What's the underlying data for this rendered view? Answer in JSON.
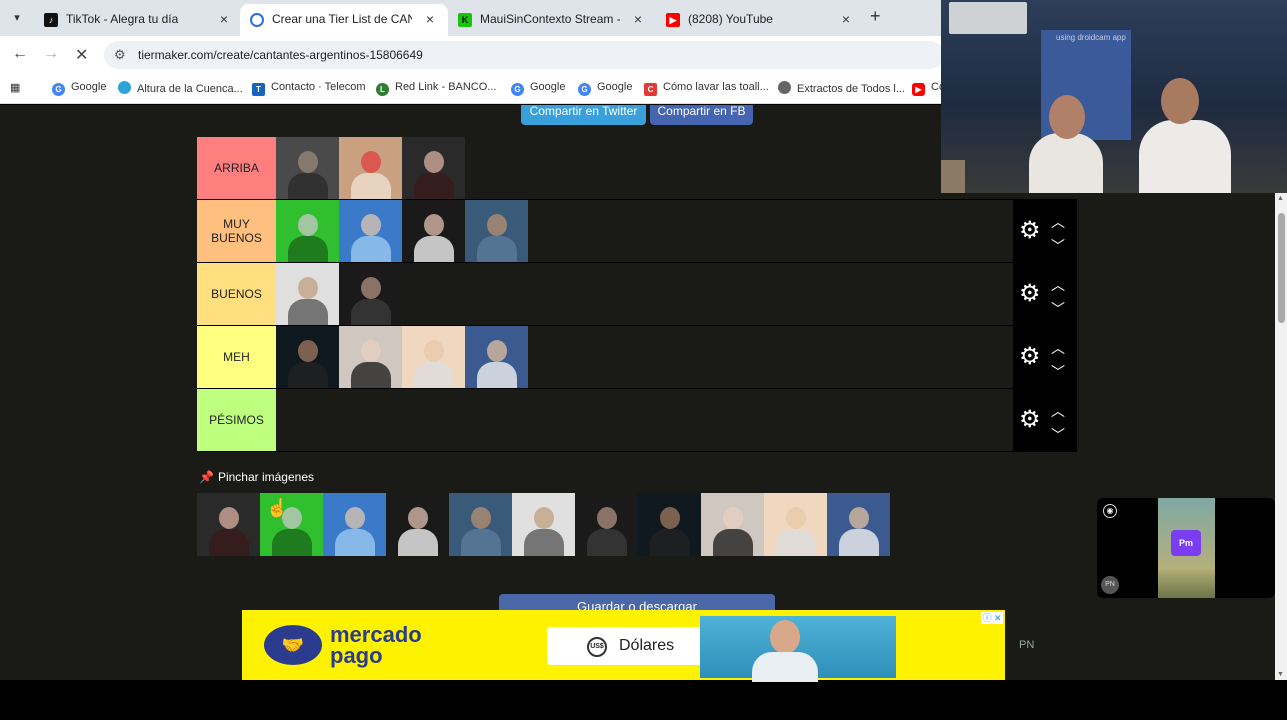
{
  "browser": {
    "tabs": [
      {
        "title": "TikTok - Alegra tu día",
        "icon": "tiktok-icon",
        "close": "×"
      },
      {
        "title": "Crear una Tier List de CANTANTES",
        "icon": "globe-icon",
        "close": "×"
      },
      {
        "title": "MauiSinContexto Stream - Watch",
        "icon": "kick-icon",
        "close": "×"
      },
      {
        "title": "(8208) YouTube",
        "icon": "youtube-icon",
        "close": "×"
      }
    ],
    "new_tab": "+",
    "url": "tiermaker.com/create/cantantes-argentinos-15806649",
    "bookmarks": [
      "Google",
      "Altura de la Cuenca...",
      "Contacto · Telecom",
      "Red Link - BANCO...",
      "Google",
      "Google",
      "Cómo lavar las toall...",
      "Extractos de Todos l...",
      "Co"
    ]
  },
  "share": {
    "twitter": "Compartir en Twitter",
    "facebook": "Compartir en FB"
  },
  "tiers": [
    {
      "label": "ARRIBA",
      "color": "#ff7f7f",
      "count": 3
    },
    {
      "label": "MUY BUENOS",
      "color": "#ffbf7f",
      "count": 4
    },
    {
      "label": "BUENOS",
      "color": "#ffdf7f",
      "count": 2
    },
    {
      "label": "MEH",
      "color": "#ffff7f",
      "count": 4
    },
    {
      "label": "PÉSIMOS",
      "color": "#bfff7f",
      "count": 0
    }
  ],
  "controls": {
    "settings_icon": "gear-icon",
    "up_icon": "chevron-up-icon",
    "down_icon": "chevron-down-icon"
  },
  "pool": {
    "label": "Pinchar imágenes",
    "count": 11
  },
  "save_button": "Guardar o descargar",
  "ad": {
    "brand": "mercado pago",
    "button": "Dólares",
    "currency_badge": "US$"
  },
  "side_text": "PN",
  "webcam": {
    "watermark": "using droidcam app"
  },
  "mini_player": {
    "badge": "Pm",
    "corner": "PN"
  }
}
